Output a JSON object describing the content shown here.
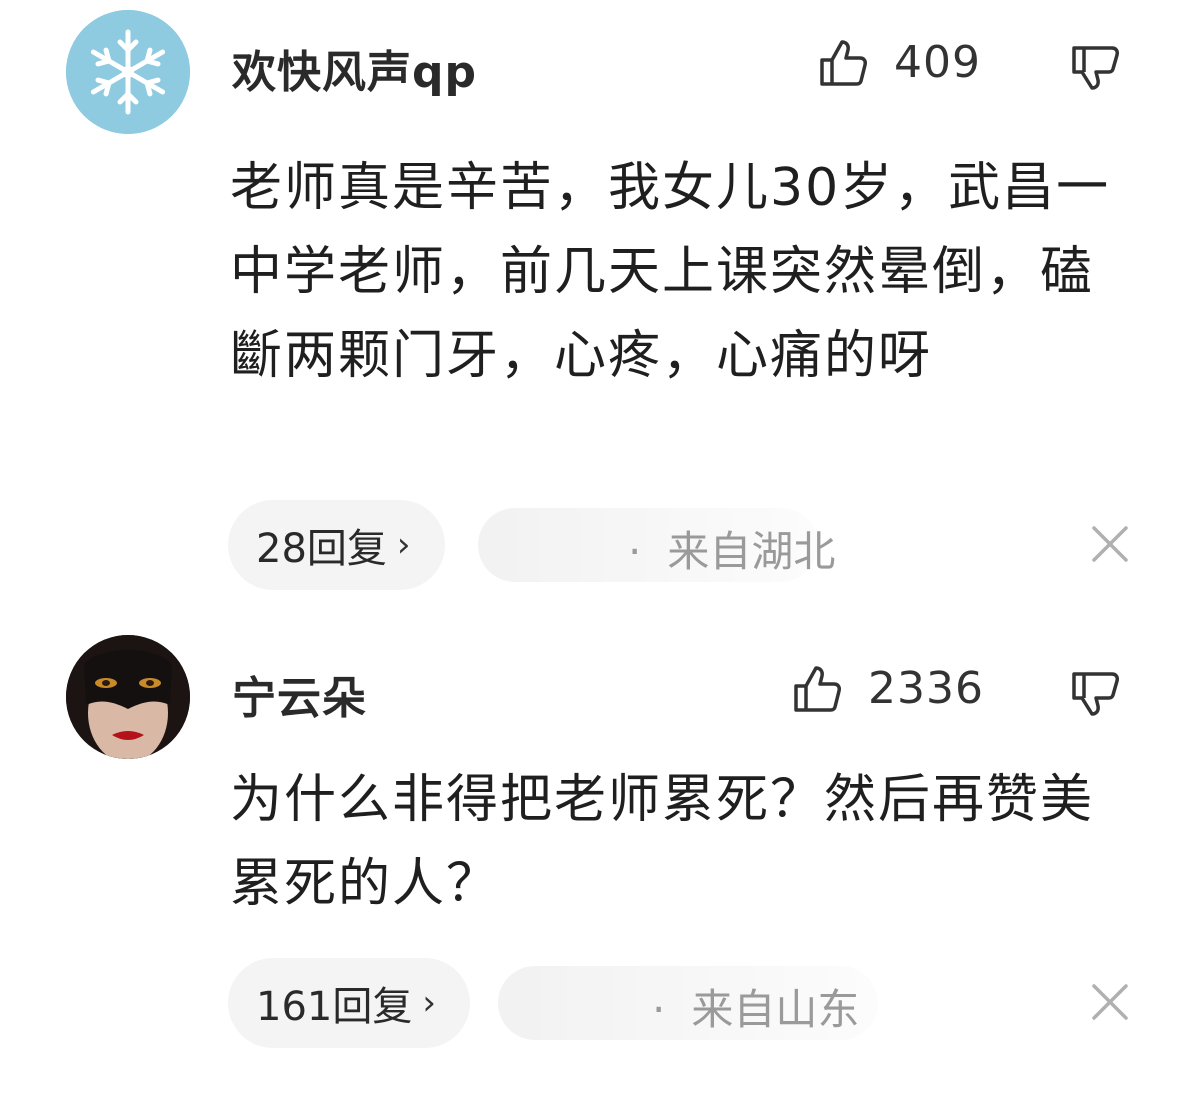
{
  "comments": [
    {
      "username": "欢快风声qp",
      "avatar_icon": "snowflake-icon",
      "likes": "409",
      "content": "老师真是辛苦，我女儿30岁，武昌一中学老师，前几天上课突然晕倒，磕斷两颗门牙，心疼，心痛的呀",
      "replies": "28回复",
      "location_dot": "·",
      "location": "来自湖北"
    },
    {
      "username": "宁云朵",
      "avatar_icon": "masked-face-avatar",
      "likes": "2336",
      "content": "为什么非得把老师累死？然后再赞美累死的人？",
      "replies": "161回复",
      "location_dot": "·",
      "location": "来自山东"
    }
  ],
  "icons": {
    "like": "thumbs-up-icon",
    "dislike": "thumbs-down-icon",
    "reply_arrow": "chevron-right-icon",
    "close": "close-icon"
  },
  "colors": {
    "avatar1_bg": "#8fcbe0",
    "text": "#1f1f1f",
    "muted": "#9a9a9a",
    "pill_bg": "#f4f4f4"
  }
}
